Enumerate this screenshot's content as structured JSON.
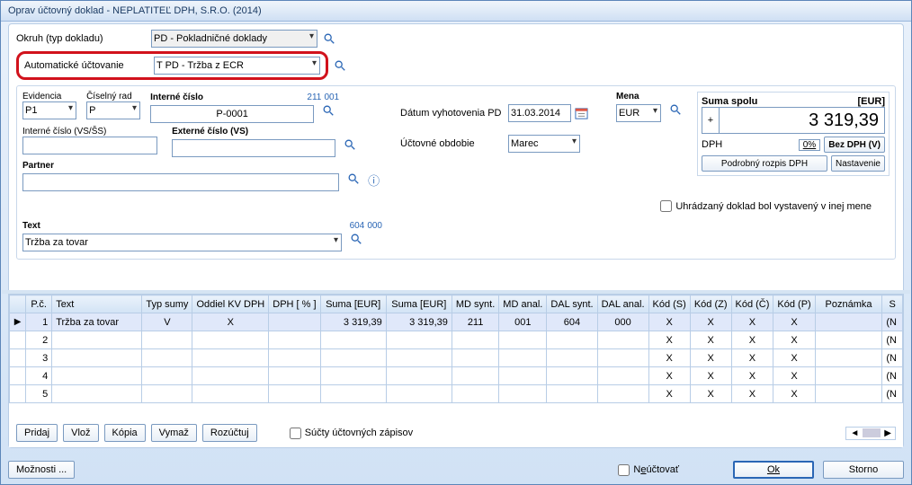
{
  "window": {
    "title": "Oprav účtovný doklad - NEPLATITEĽ DPH, S.R.O. (2014)"
  },
  "okruh": {
    "label": "Okruh (typ dokladu)",
    "value": "PD - Pokladničné doklady"
  },
  "auto_acc": {
    "label": "Automatické účtovanie",
    "value": "T PD - Tržba z ECR"
  },
  "evidencia": {
    "label": "Evidencia",
    "value": "P1"
  },
  "ciselny_rad": {
    "label": "Číselný rad",
    "value": "P"
  },
  "interne_cislo": {
    "label": "Interné číslo",
    "code1": "211",
    "code2": "001",
    "value": "P-0001"
  },
  "interne_vs": {
    "label": "Interné číslo (VS/ŠS)",
    "value": ""
  },
  "externe_vs": {
    "label": "Externé číslo (VS)",
    "value": ""
  },
  "partner": {
    "label": "Partner",
    "value": ""
  },
  "text": {
    "label": "Text",
    "code1": "604",
    "code2": "000",
    "value": "Tržba za tovar"
  },
  "datum_vyhot": {
    "label": "Dátum vyhotovenia PD",
    "value": "31.03.2014"
  },
  "uct_obdobie": {
    "label": "Účtovné obdobie",
    "value": "Marec"
  },
  "mena": {
    "label": "Mena",
    "value": "EUR"
  },
  "suma": {
    "label": "Suma spolu",
    "ccy": "[EUR]",
    "sign": "+",
    "value": "3 319,39",
    "dph_label": "DPH",
    "dph_pct": "0%",
    "bez_dph_btn": "Bez DPH (V)",
    "rozpis_btn": "Podrobný rozpis DPH",
    "nastavenie_btn": "Nastavenie"
  },
  "uhr_chk": {
    "label": "Uhrádzaný doklad bol vystavený v inej mene"
  },
  "grid": {
    "headers": [
      "",
      "P.č.",
      "Text",
      "Typ sumy",
      "Oddiel KV DPH",
      "DPH [ % ]",
      "Suma [EUR]",
      "Suma [EUR]",
      "MD synt.",
      "MD anal.",
      "DAL synt.",
      "DAL anal.",
      "Kód (S)",
      "Kód (Z)",
      "Kód (Č)",
      "Kód (P)",
      "Poznámka",
      "S"
    ],
    "rows": [
      {
        "arrow": "▶",
        "pc": "1",
        "text": "Tržba za tovar",
        "typ": "V",
        "kvdph": "X",
        "dphp": "",
        "s1": "3 319,39",
        "s2": "3 319,39",
        "mds": "211",
        "mda": "001",
        "dals": "604",
        "dala": "000",
        "ks": "X",
        "kz": "X",
        "kc": "X",
        "kp": "X",
        "pozn": "",
        "last": "(N"
      },
      {
        "arrow": "",
        "pc": "2",
        "text": "",
        "typ": "",
        "kvdph": "",
        "dphp": "",
        "s1": "",
        "s2": "",
        "mds": "",
        "mda": "",
        "dals": "",
        "dala": "",
        "ks": "X",
        "kz": "X",
        "kc": "X",
        "kp": "X",
        "pozn": "",
        "last": "(N"
      },
      {
        "arrow": "",
        "pc": "3",
        "text": "",
        "typ": "",
        "kvdph": "",
        "dphp": "",
        "s1": "",
        "s2": "",
        "mds": "",
        "mda": "",
        "dals": "",
        "dala": "",
        "ks": "X",
        "kz": "X",
        "kc": "X",
        "kp": "X",
        "pozn": "",
        "last": "(N"
      },
      {
        "arrow": "",
        "pc": "4",
        "text": "",
        "typ": "",
        "kvdph": "",
        "dphp": "",
        "s1": "",
        "s2": "",
        "mds": "",
        "mda": "",
        "dals": "",
        "dala": "",
        "ks": "X",
        "kz": "X",
        "kc": "X",
        "kp": "X",
        "pozn": "",
        "last": "(N"
      },
      {
        "arrow": "",
        "pc": "5",
        "text": "",
        "typ": "",
        "kvdph": "",
        "dphp": "",
        "s1": "",
        "s2": "",
        "mds": "",
        "mda": "",
        "dals": "",
        "dala": "",
        "ks": "X",
        "kz": "X",
        "kc": "X",
        "kp": "X",
        "pozn": "",
        "last": "(N"
      }
    ],
    "buttons": {
      "pridaj": "Pridaj",
      "vloz": "Vlož",
      "kopia": "Kópia",
      "vymaz": "Vymaž",
      "rozuctuj": "Rozúčtuj"
    },
    "sucty_chk": "Súčty účtovných zápisov"
  },
  "footer": {
    "moznosti": "Možnosti ...",
    "neuctovat": "Neúčtovať",
    "ok": "Ok",
    "storno": "Storno"
  }
}
